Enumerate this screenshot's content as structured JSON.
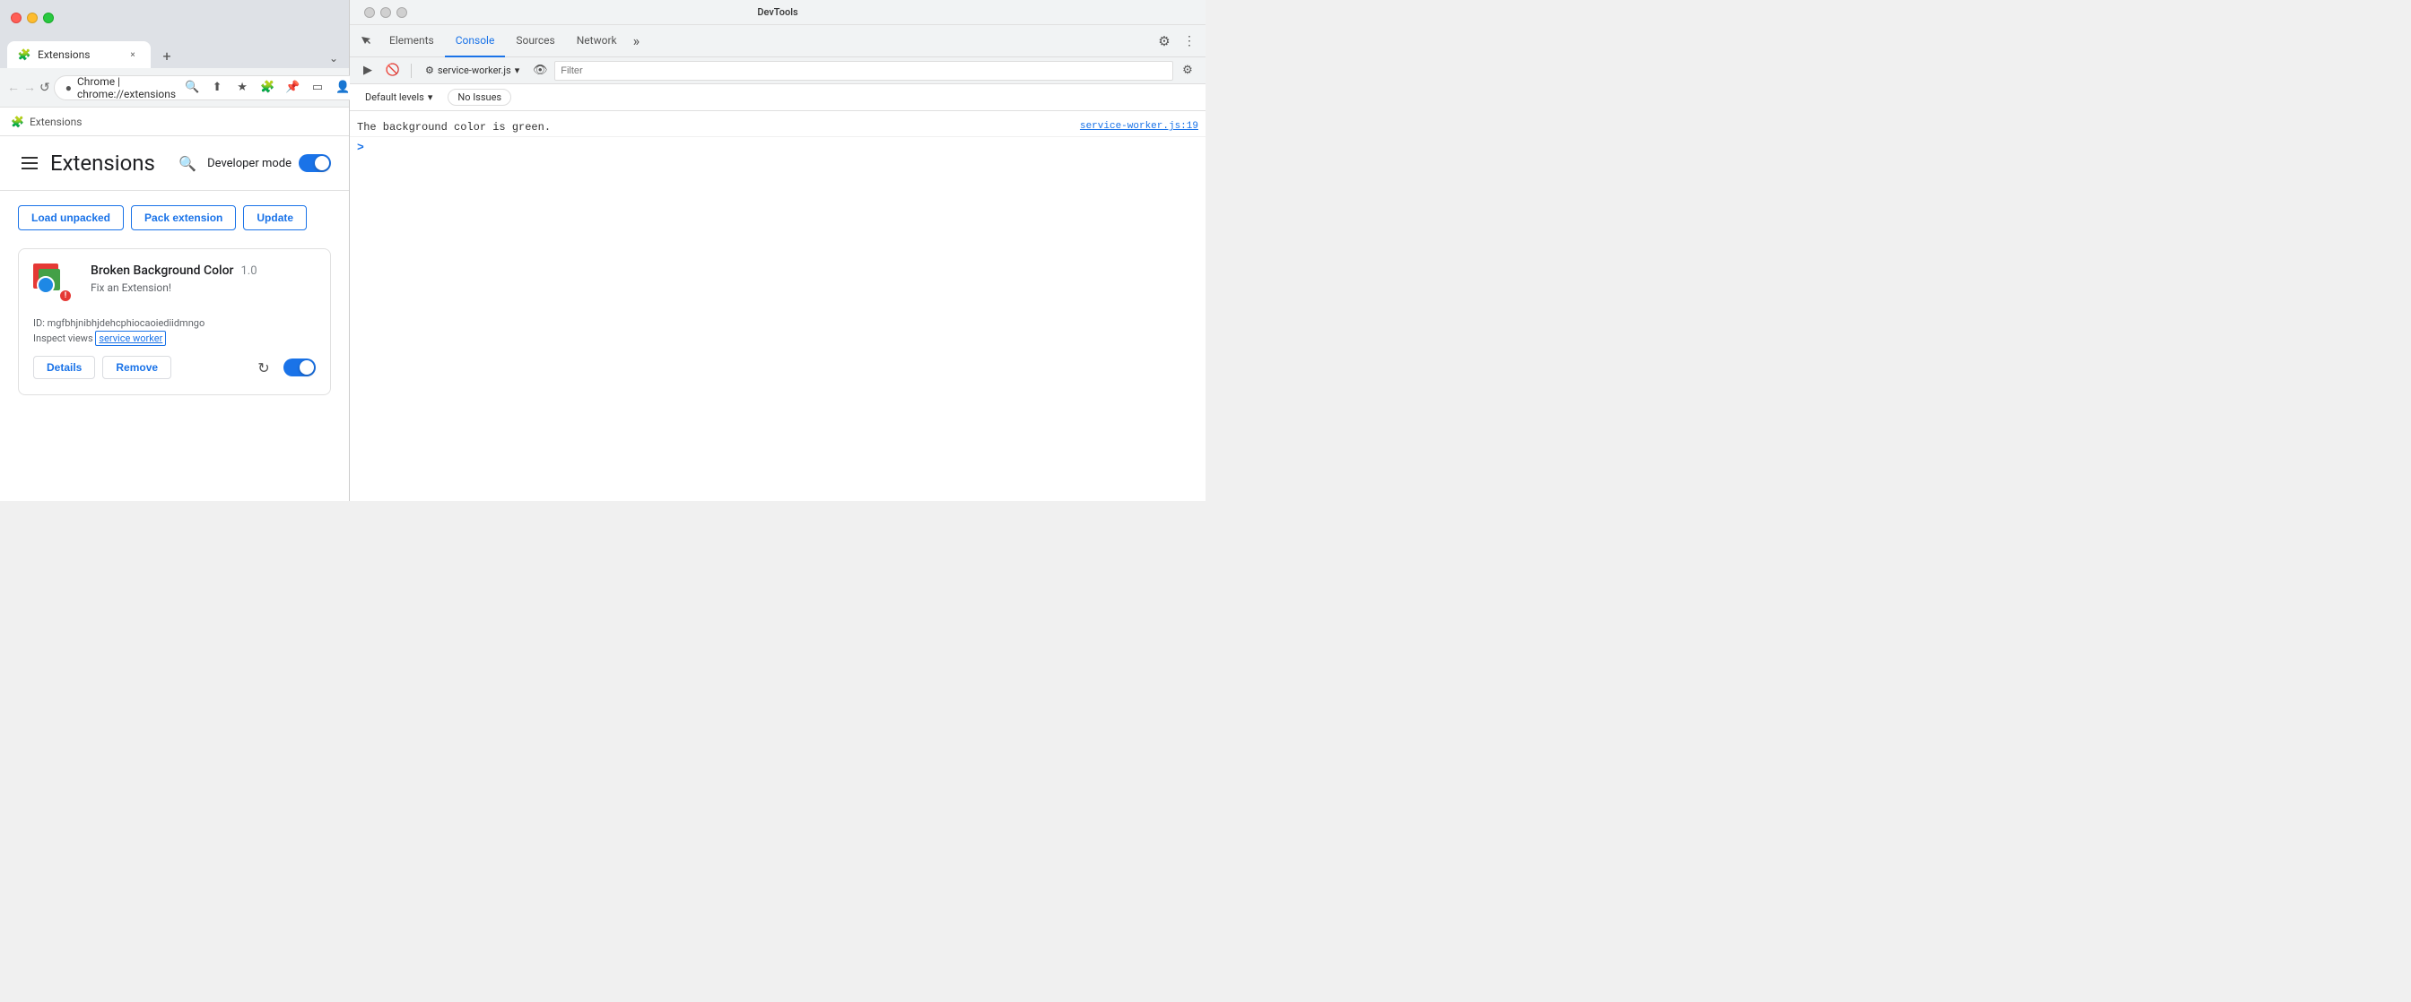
{
  "browser": {
    "traffic_lights": [
      "red",
      "yellow",
      "green"
    ],
    "tab": {
      "favicon": "🧩",
      "title": "Extensions",
      "close_label": "×"
    },
    "new_tab_label": "+",
    "tab_overflow_label": "⌄",
    "nav": {
      "back_label": "←",
      "forward_label": "→",
      "reload_label": "↺",
      "url_icon": "●",
      "url_prefix": "Chrome  |  ",
      "url": "chrome://extensions",
      "zoom_btn": "🔍",
      "share_btn": "⬆",
      "star_btn": "★",
      "ext_btn": "🧩",
      "pin_btn": "📌",
      "cast_btn": "▭",
      "profile_btn": "👤",
      "menu_btn": "⋮"
    },
    "breadcrumb": {
      "icon": "🧩",
      "label": "Extensions"
    }
  },
  "extensions_page": {
    "hamburger_label": "☰",
    "title": "Extensions",
    "search_label": "🔍",
    "dev_mode_label": "Developer mode",
    "load_unpacked_label": "Load unpacked",
    "pack_extension_label": "Pack extension",
    "update_label": "Update",
    "card": {
      "name": "Broken Background Color",
      "version": "1.0",
      "description": "Fix an Extension!",
      "id_label": "ID: mgfbhjnibhjdehcphiocaoiediidmngo",
      "inspect_views_label": "Inspect views",
      "service_worker_link": "service worker",
      "details_btn": "Details",
      "remove_btn": "Remove",
      "refresh_label": "↻"
    }
  },
  "devtools": {
    "title": "DevTools",
    "traffic_lights": [
      "●",
      "●",
      "●"
    ],
    "sidebar_btn": "⬛",
    "tabs": [
      {
        "label": "Elements",
        "active": false
      },
      {
        "label": "Console",
        "active": true
      },
      {
        "label": "Sources",
        "active": false
      },
      {
        "label": "Network",
        "active": false
      }
    ],
    "tab_more_label": "»",
    "settings_label": "⚙",
    "menu_label": "⋮",
    "toolbar": {
      "play_btn": "▶",
      "ban_btn": "🚫",
      "context_icon": "⚙",
      "context_label": "service-worker.js",
      "context_arrow": "▾",
      "eye_icon": "👁",
      "filter_placeholder": "Filter",
      "filter_settings": "⚙"
    },
    "levels": {
      "default_label": "Default levels",
      "arrow": "▾",
      "no_issues_label": "No Issues"
    },
    "console": {
      "log_message": "The background color is green.",
      "log_source": "service-worker.js:19",
      "prompt_arrow": ">"
    }
  }
}
